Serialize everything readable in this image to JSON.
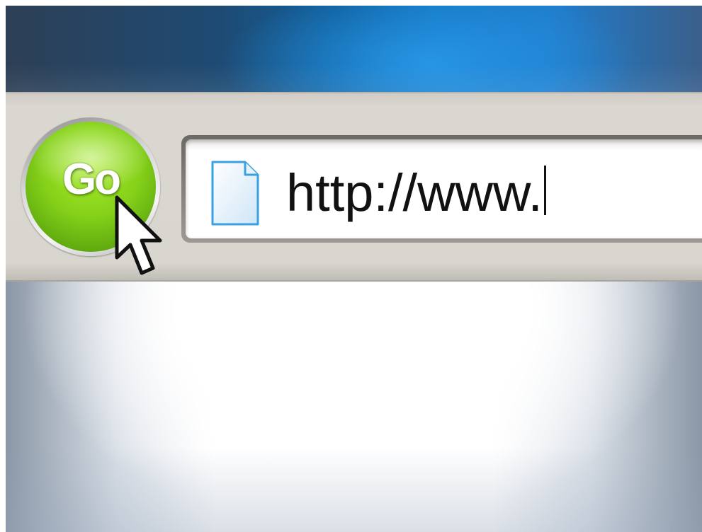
{
  "toolbar": {
    "go_button": {
      "label": "Go",
      "color": "#86d21a"
    },
    "address_bar": {
      "url": "http://www.",
      "page_icon": "document-page-icon"
    }
  },
  "title_bar": {
    "color": "#1478c4"
  },
  "cursor": {
    "icon": "mouse-pointer-arrow"
  }
}
